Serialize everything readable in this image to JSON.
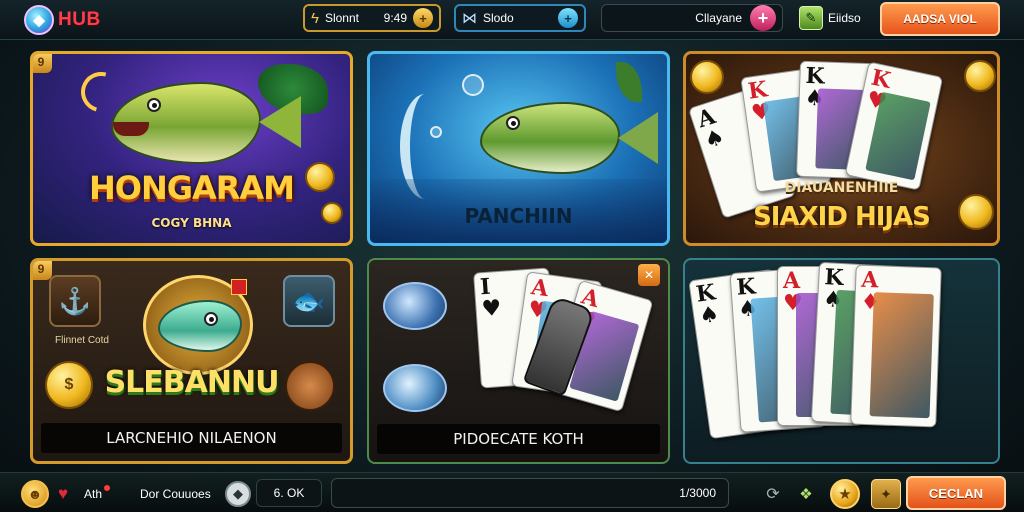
{
  "topbar": {
    "logo_text": "HUB",
    "gold_pill": {
      "label": "Slonnt",
      "value": "9:49",
      "button": "+"
    },
    "blue_pill": {
      "label": "Slodo",
      "button": "+"
    },
    "dark_pill": {
      "label": "Cllayane",
      "button": "+"
    },
    "edit_label": "Eiidso",
    "cta_label": "AADSA VIOL"
  },
  "games": [
    {
      "title": "HONGARAM",
      "subtitle": "COGY BHNA",
      "badge": "9"
    },
    {
      "title": "PANCHIIN"
    },
    {
      "title_small": "DIAUANENHIIE",
      "title": "SIAXID HIJAS"
    },
    {
      "title": "SLEBANNU",
      "icon_label": "Flinnet Cotd",
      "bar_label": "LARCNEHIO NILAENON",
      "badge": "9"
    },
    {
      "bar_label": "PIDOECATE KOTH",
      "badge": "✕"
    },
    {}
  ],
  "cards": {
    "c3": [
      {
        "rank": "A",
        "suit": "♠",
        "color": "blk"
      },
      {
        "rank": "K",
        "suit": "♥",
        "color": "red"
      },
      {
        "rank": "K",
        "suit": "♠",
        "color": "blk"
      },
      {
        "rank": "K",
        "suit": "♥",
        "color": "red"
      }
    ],
    "c5": [
      {
        "rank": "I",
        "suit": "♥",
        "color": "blk"
      },
      {
        "rank": "A",
        "suit": "♥",
        "color": "red"
      },
      {
        "rank": "A",
        "suit": "♥",
        "color": "red"
      }
    ],
    "c6": [
      {
        "rank": "K",
        "suit": "♠",
        "color": "blk"
      },
      {
        "rank": "K",
        "suit": "♠",
        "color": "blk"
      },
      {
        "rank": "A",
        "suit": "♥",
        "color": "red"
      },
      {
        "rank": "K",
        "suit": "♠",
        "color": "blk"
      },
      {
        "rank": "A",
        "suit": "♦",
        "color": "red"
      }
    ]
  },
  "bottombar": {
    "account_label": "Ath",
    "dm_label": "Dor Couuoes",
    "balance": "6. OK",
    "long_value": "1/3000",
    "cta_label": "CECLAN"
  },
  "icons": {
    "logo": "hub-logo-icon",
    "gold": "lightning-icon",
    "blue": "fish-icon",
    "edit": "edit-icon"
  }
}
